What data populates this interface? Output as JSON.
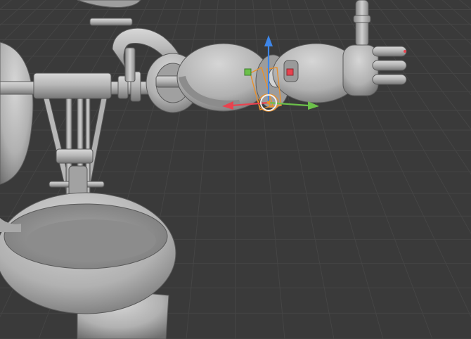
{
  "viewport": {
    "background_color": "#3a3a3a",
    "grid_line_color": "#454545",
    "mesh_base_color": "#b9b9b9",
    "mesh_shadow_color": "#6e6e6e",
    "mesh_highlight_color": "#d9d9d9",
    "selection_outline_color": "#e8902c"
  },
  "gizmo": {
    "x_axis_color": "#e8434f",
    "y_axis_color": "#6cc04a",
    "z_axis_color": "#3e86e8",
    "center_ring_color": "#f0f0f0"
  },
  "scene_objects": [
    "bowl-base",
    "left-torso-shell",
    "armature-rods",
    "mounting-bracket",
    "upper-arm",
    "forearm",
    "hand",
    "vertical-tube"
  ]
}
